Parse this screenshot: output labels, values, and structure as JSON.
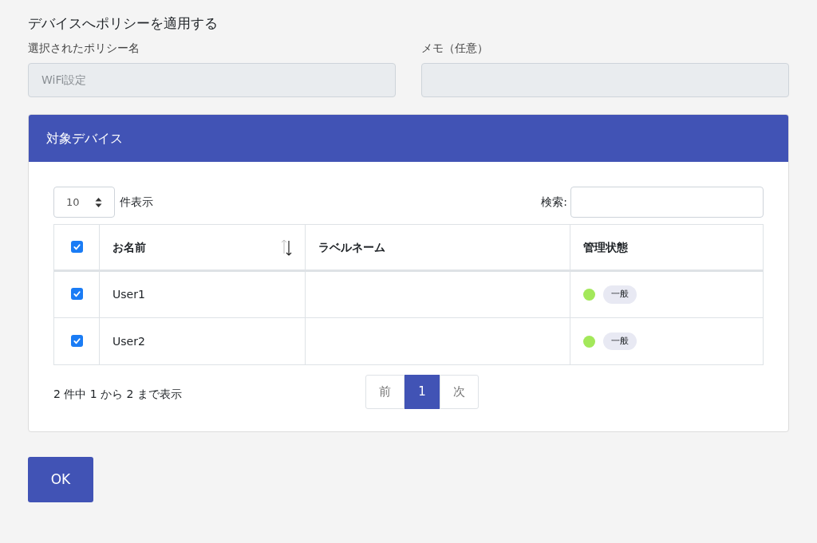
{
  "title": "デバイスへポリシーを適用する",
  "fields": [
    {
      "label": "選択されたポリシー名",
      "value": "WiFi設定",
      "disabled": true
    },
    {
      "label": "メモ（任意）",
      "disabled": true
    }
  ],
  "panel": {
    "title": "対象デバイス",
    "length": {
      "value": "10",
      "label": "件表示"
    },
    "search": {
      "label": "検索:"
    },
    "table": {
      "select_all": {
        "checked": true
      },
      "columns": [
        {
          "label": "お名前",
          "sortable": true
        },
        {
          "label": "ラベルネーム",
          "sortable": false
        },
        {
          "label": "管理状態",
          "sortable": false
        }
      ],
      "rows": [
        {
          "checked": true,
          "name": "User1",
          "status": {
            "color": "#a3e85a",
            "badge": "一般"
          }
        },
        {
          "checked": true,
          "name": "User2",
          "status": {
            "color": "#a3e85a",
            "badge": "一般"
          }
        }
      ]
    },
    "info": "2 件中 1 から 2 まで表示",
    "pagination": [
      {
        "label": "前",
        "selected": false,
        "disabled": true
      },
      {
        "label": "1",
        "selected": true,
        "disabled": false
      },
      {
        "label": "次",
        "selected": false,
        "disabled": true
      }
    ]
  },
  "ok_button": "OK"
}
